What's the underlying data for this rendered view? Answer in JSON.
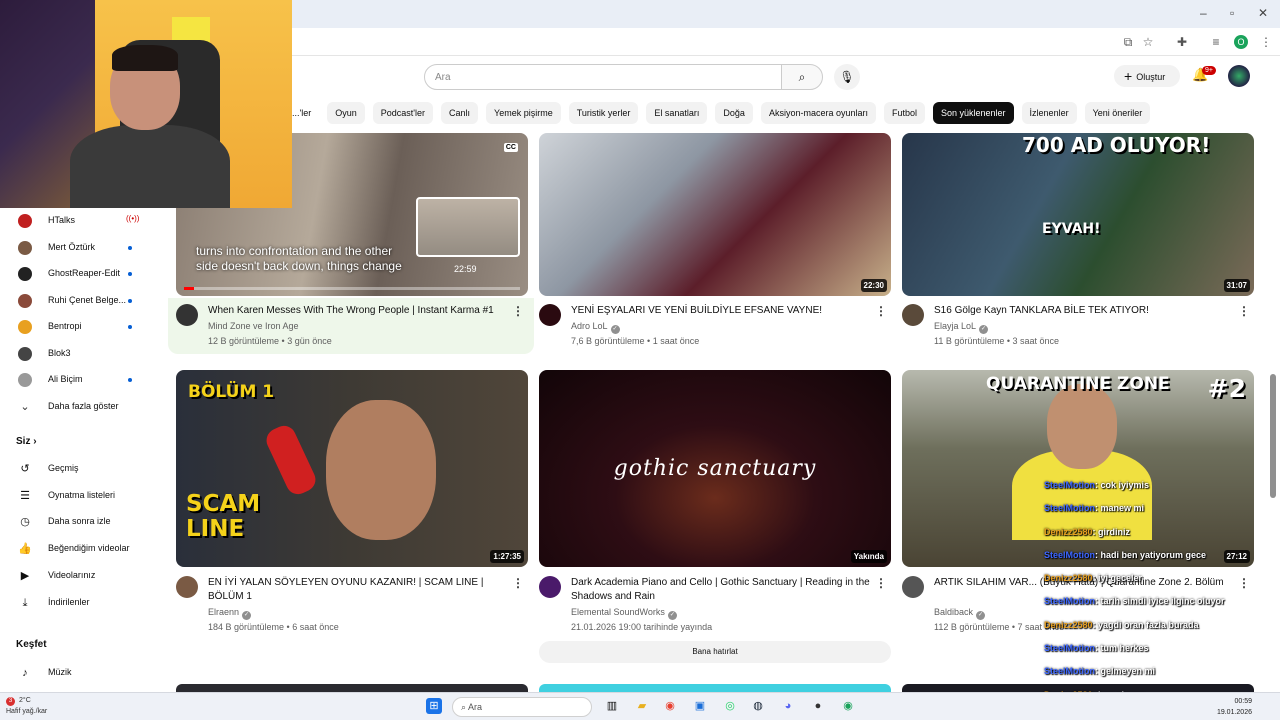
{
  "browser": {
    "profile_initial": "O"
  },
  "header": {
    "search_placeholder": "Ara",
    "create_label": "Oluştur",
    "notif_count": "9+"
  },
  "chips": [
    "...'ler",
    "Oyun",
    "Podcast'ler",
    "Canlı",
    "Yemek pişirme",
    "Turistik yerler",
    "El sanatları",
    "Doğa",
    "Aksiyon-macera oyunları",
    "Futbol",
    "Son yüklenenler",
    "İzlenenler",
    "Yeni öneriler"
  ],
  "active_chip_index": 10,
  "sidebar": {
    "subscriptions": [
      {
        "label": "HTalks",
        "live": true
      },
      {
        "label": "Mert Öztürk",
        "dot": true
      },
      {
        "label": "GhostReaper-Edit",
        "dot": true
      },
      {
        "label": "Ruhi Çenet Belge...",
        "dot": true
      },
      {
        "label": "Bentropi",
        "dot": true
      },
      {
        "label": "Blok3",
        "dot": false
      },
      {
        "label": "Ali Biçim",
        "dot": true
      },
      {
        "label": "Daha fazla göster",
        "dot": false
      }
    ],
    "you_heading": "Siz",
    "you_items": [
      "Geçmiş",
      "Oynatma listeleri",
      "Daha sonra izle",
      "Beğendiğim videolar",
      "Videolarınız",
      "İndirilenler"
    ],
    "explore_heading": "Keşfet",
    "explore_items": [
      "Müzik"
    ]
  },
  "videos": [
    {
      "title": "When Karen Messes With The Wrong People | Instant Karma #1",
      "channel": "Mind Zone ve Iron Age",
      "stats": "12 B görüntüleme • 3 gün önce",
      "duration": "22:59",
      "subtitle_line1": "turns into confrontation and the other",
      "subtitle_line2": "side doesn't back down, things change",
      "cc": "CC",
      "progress": 0.03
    },
    {
      "title": "YENİ EŞYALARI VE YENİ BUİLDİYLE EFSANE VAYNE!",
      "channel": "Adro LoL",
      "stats": "7,6 B görüntüleme • 1 saat önce",
      "duration": "22:30"
    },
    {
      "title": "S16 Gölge Kayn TANKLARA BİLE TEK ATIYOR!",
      "channel": "Elayja LoL",
      "stats": "11 B görüntüleme • 3 saat önce",
      "duration": "31:07",
      "thumb_banner": "700 AD OLUYOR!",
      "thumb_sub": "EYVAH!"
    },
    {
      "title": "EN İYİ YALAN SÖYLEYEN OYUNU KAZANIR! | SCAM LINE | BÖLÜM 1",
      "channel": "Elraenn",
      "stats": "184 B görüntüleme • 6 saat önce",
      "duration": "1:27:35",
      "thumb_top": "BÖLÜM 1",
      "thumb_bottom1": "SCAM",
      "thumb_bottom2": "LINE"
    },
    {
      "title": "Dark Academia Piano and Cello | Gothic Sanctuary | Reading in the Shadows and Rain",
      "channel": "Elemental SoundWorks",
      "stats": "21.01.2026 19:00 tarihinde yayında",
      "duration": "Yakında",
      "thumb_text": "gothic sanctuary",
      "remind_label": "Bana hatırlat"
    },
    {
      "title": "ARTIK SILAHIM VAR... (Büyük Hata) | Quarantine Zone 2. Bölüm",
      "channel": "Baldiback",
      "stats": "112 B görüntüleme • 7 saat önce",
      "duration": "27:12",
      "thumb_top": "QUARANTINE ZONE",
      "thumb_num": "#2"
    }
  ],
  "chat": [
    {
      "user": "SteelMotion",
      "msg": "cok iyiymis",
      "type": 1
    },
    {
      "user": "SteelMotion",
      "msg": "manew mi",
      "type": 1
    },
    {
      "user": "Denizz2580",
      "msg": "girdiniz",
      "type": 2
    },
    {
      "user": "SteelMotion",
      "msg": "hadi ben yatiyorum gece",
      "type": 1
    },
    {
      "user": "Denizz2580",
      "msg": "iyi geceler",
      "type": 2
    },
    {
      "user": "SteelMotion",
      "msg": "tarih simdi iyice ilginc oluyor",
      "type": 1
    },
    {
      "user": "Denizz2580",
      "msg": "yagdi oran fazla burada",
      "type": 2
    },
    {
      "user": "SteelMotion",
      "msg": "tum herkes",
      "type": 1
    },
    {
      "user": "SteelMotion",
      "msg": "gelmeyen mi",
      "type": 1
    },
    {
      "user": "Denizz2580",
      "msg": "ben aksam",
      "type": 2
    }
  ],
  "taskbar": {
    "temp": "2°C",
    "weather": "Hafif yağ./kar",
    "weather_badge": "3",
    "search": "Ara",
    "time": "00:59",
    "date": "19.01.2026"
  }
}
